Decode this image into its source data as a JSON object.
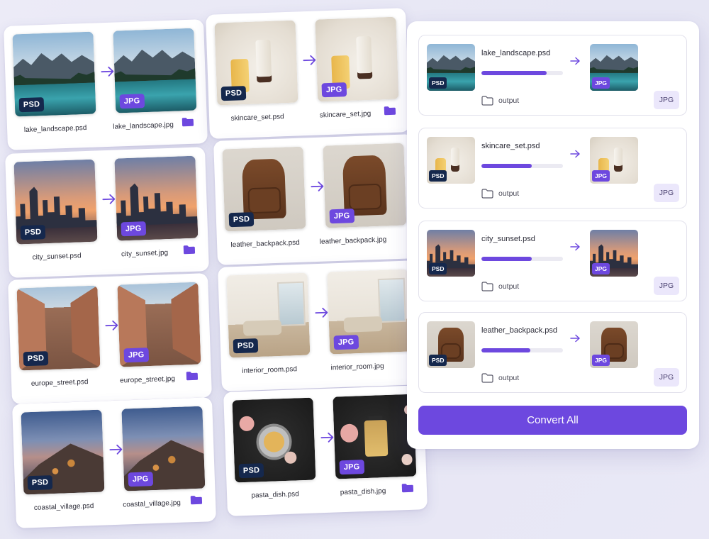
{
  "pairs": [
    {
      "src_name": "lake_landscape.psd",
      "dst_name": "lake_landscape.jpg"
    },
    {
      "src_name": "skincare_set.psd",
      "dst_name": "skincare_set.jpg"
    },
    {
      "src_name": "city_sunset.psd",
      "dst_name": "city_sunset.jpg"
    },
    {
      "src_name": "leather_backpack.psd",
      "dst_name": "leather_backpack.jpg"
    },
    {
      "src_name": "europe_street.psd",
      "dst_name": "europe_street.jpg"
    },
    {
      "src_name": "interior_room.psd",
      "dst_name": "interior_room.jpg"
    },
    {
      "src_name": "coastal_village.psd",
      "dst_name": "coastal_village.jpg"
    },
    {
      "src_name": "pasta_dish.psd",
      "dst_name": "pasta_dish.jpg"
    }
  ],
  "badges": {
    "psd": "PSD",
    "jpg": "JPG"
  },
  "queue": [
    {
      "name": "lake_landscape.psd",
      "progress": 0.8,
      "output": "output",
      "format": "JPG"
    },
    {
      "name": "skincare_set.psd",
      "progress": 0.62,
      "output": "output",
      "format": "JPG"
    },
    {
      "name": "city_sunset.psd",
      "progress": 0.62,
      "output": "output",
      "format": "JPG"
    },
    {
      "name": "leather_backpack.psd",
      "progress": 0.6,
      "output": "output",
      "format": "JPG"
    }
  ],
  "convert_label": "Convert All",
  "colors": {
    "accent": "#6d48df",
    "psd_badge": "#15284d",
    "background": "#e9e8f6"
  }
}
